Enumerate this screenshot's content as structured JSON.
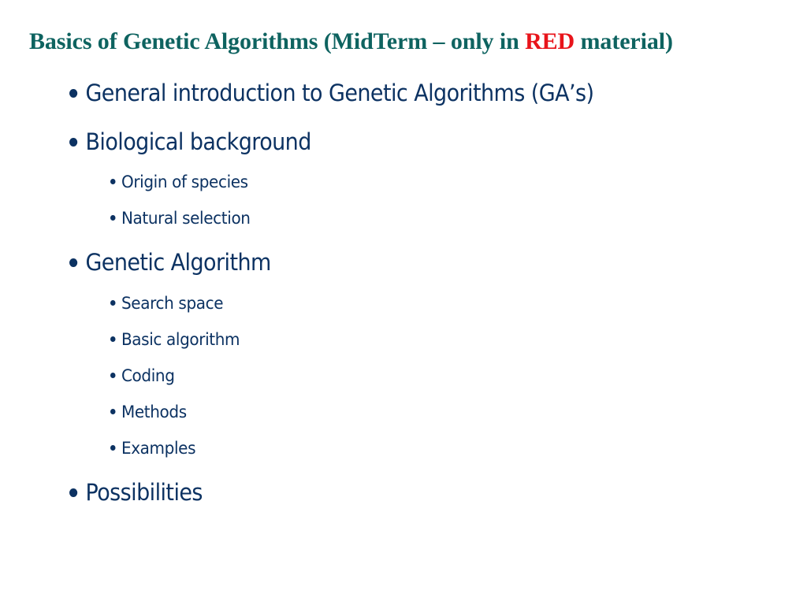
{
  "slide": {
    "title": {
      "prefix": "Basics of Genetic Algorithms (MidTerm – only in ",
      "highlight": "RED",
      "suffix": " material)",
      "color": "#0e6360",
      "highlight_color": "#e8141b"
    },
    "text_color": "#0c3262",
    "bullets": [
      {
        "level": 1,
        "text": "General introduction to Genetic Algorithms (GA’s)"
      },
      {
        "level": 1,
        "text": "Biological background"
      },
      {
        "level": 2,
        "text": "Origin of species"
      },
      {
        "level": 2,
        "text": "Natural selection"
      },
      {
        "level": 1,
        "text": "Genetic Algorithm"
      },
      {
        "level": 2,
        "text": "Search space"
      },
      {
        "level": 2,
        "text": "Basic algorithm"
      },
      {
        "level": 2,
        "text": "Coding"
      },
      {
        "level": 2,
        "text": "Methods"
      },
      {
        "level": 2,
        "text": "Examples"
      },
      {
        "level": 1,
        "text": "Possibilities"
      }
    ]
  }
}
